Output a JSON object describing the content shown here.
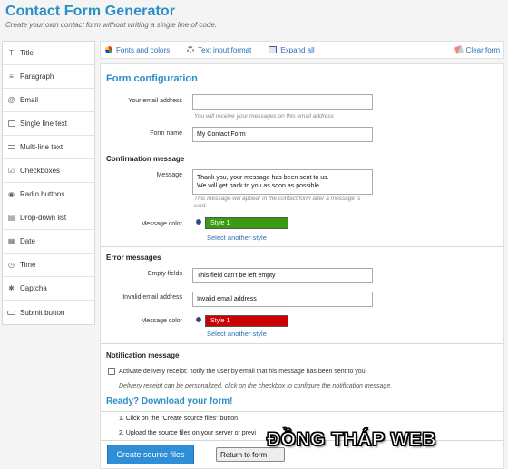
{
  "app": {
    "title": "Contact Form Generator",
    "subtitle": "Create your own contact form without writing a single line of code."
  },
  "sidebar": {
    "items": [
      {
        "label": "Title",
        "icon": "title-icon"
      },
      {
        "label": "Paragraph",
        "icon": "paragraph-icon"
      },
      {
        "label": "Email",
        "icon": "at-icon"
      },
      {
        "label": "Single line text",
        "icon": "text-field-icon"
      },
      {
        "label": "Multi-line text",
        "icon": "textarea-icon"
      },
      {
        "label": "Checkboxes",
        "icon": "checkbox-icon"
      },
      {
        "label": "Radio buttons",
        "icon": "radio-icon"
      },
      {
        "label": "Drop-down list",
        "icon": "dropdown-icon"
      },
      {
        "label": "Date",
        "icon": "calendar-icon"
      },
      {
        "label": "Time",
        "icon": "clock-icon"
      },
      {
        "label": "Captcha",
        "icon": "captcha-icon"
      },
      {
        "label": "Submit button",
        "icon": "button-icon"
      }
    ]
  },
  "toolbar": {
    "fonts_colors": "Fonts and colors",
    "text_input_format": "Text input format",
    "expand_all": "Expand all",
    "clear_form": "Clear form"
  },
  "form_config": {
    "heading": "Form configuration",
    "email_label": "Your email address",
    "email_value": "",
    "email_help": "You will receive your messages on this email address",
    "name_label": "Form name",
    "name_value": "My Contact Form"
  },
  "confirmation": {
    "heading": "Confirmation message",
    "message_label": "Message",
    "message_line1": "Thank you, your message has been sent to us.",
    "message_line2": "We will get back to you as soon as possible.",
    "help_line1": "This message will appear in the contact form after a message is",
    "help_line2": "sent.",
    "color_label": "Message color",
    "style_name": "Style 1",
    "style_color": "#3a9a12",
    "select_style": "Select another style"
  },
  "errors": {
    "heading": "Error messages",
    "empty_label": "Empty fields",
    "empty_value": "This field can't be left empty",
    "invalid_label": "Invalid email address",
    "invalid_value": "Invalid email address",
    "color_label": "Message color",
    "style_name": "Style 1",
    "style_color": "#cc0000",
    "select_style": "Select another style"
  },
  "notification": {
    "heading": "Notification message",
    "checkbox_label": "Activate delivery receipt: notify the user by email that his message has been sent to you",
    "help": "Delivery receipt can be personalized, click on the checkbox to configure the notification message."
  },
  "download": {
    "heading": "Ready? Download your form!",
    "step1": "1. Click on the \"Create source files\" button",
    "step2": "2. Upload the source files on your server or previ",
    "create_button": "Create source files",
    "return_button": "Return to form"
  },
  "watermark": "ĐỒNG THÁP WEB",
  "colors": {
    "accent": "#2a8fc7",
    "link": "#2a6fb5",
    "primary_button": "#2f8fd6"
  }
}
